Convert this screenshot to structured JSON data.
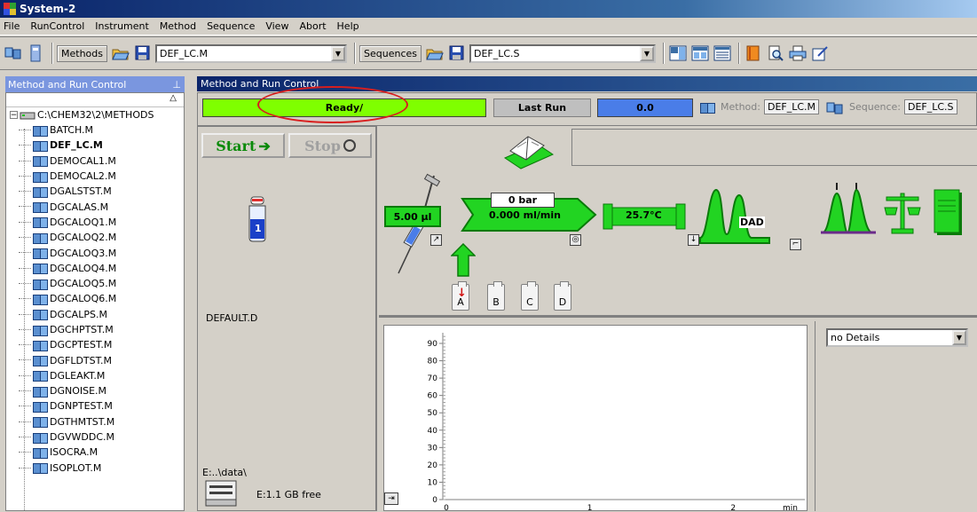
{
  "window": {
    "title": "System-2"
  },
  "menu": [
    "File",
    "RunControl",
    "Instrument",
    "Method",
    "Sequence",
    "View",
    "Abort",
    "Help"
  ],
  "toolbar": {
    "methods_label": "Methods",
    "method_value": "DEF_LC.M",
    "sequences_label": "Sequences",
    "sequence_value": "DEF_LC.S"
  },
  "left_panel": {
    "header": "Method and Run Control",
    "pin": "⊥",
    "sort_indicator": "△",
    "root_path": "C:\\CHEM32\\2\\METHODS",
    "items": [
      {
        "label": "BATCH.M",
        "bold": false
      },
      {
        "label": "DEF_LC.M",
        "bold": true
      },
      {
        "label": "DEMOCAL1.M",
        "bold": false
      },
      {
        "label": "DEMOCAL2.M",
        "bold": false
      },
      {
        "label": "DGALSTST.M",
        "bold": false
      },
      {
        "label": "DGCALAS.M",
        "bold": false
      },
      {
        "label": "DGCALOQ1.M",
        "bold": false
      },
      {
        "label": "DGCALOQ2.M",
        "bold": false
      },
      {
        "label": "DGCALOQ3.M",
        "bold": false
      },
      {
        "label": "DGCALOQ4.M",
        "bold": false
      },
      {
        "label": "DGCALOQ5.M",
        "bold": false
      },
      {
        "label": "DGCALOQ6.M",
        "bold": false
      },
      {
        "label": "DGCALPS.M",
        "bold": false
      },
      {
        "label": "DGCHPTST.M",
        "bold": false
      },
      {
        "label": "DGCPTEST.M",
        "bold": false
      },
      {
        "label": "DGFLDTST.M",
        "bold": false
      },
      {
        "label": "DGLEAKT.M",
        "bold": false
      },
      {
        "label": "DGNOISE.M",
        "bold": false
      },
      {
        "label": "DGNPTEST.M",
        "bold": false
      },
      {
        "label": "DGTHMTST.M",
        "bold": false
      },
      {
        "label": "DGVWDDC.M",
        "bold": false
      },
      {
        "label": "ISOCRA.M",
        "bold": false
      },
      {
        "label": "ISOPLOT.M",
        "bold": false
      }
    ]
  },
  "main": {
    "header": "Method and Run Control",
    "status": "Ready/",
    "last_run_label": "Last Run",
    "last_run_value": "0.0",
    "method_label": "Method:",
    "method_value": "DEF_LC.M",
    "sequence_label": "Sequence:",
    "sequence_value": "DEF_LC.S"
  },
  "run_control": {
    "start_label": "Start",
    "stop_label": "Stop",
    "vial_number": "1",
    "datafile": "DEFAULT.D",
    "data_path": "E:..\\data\\",
    "free_space": "E:1.1 GB free"
  },
  "instrument": {
    "injection_volume": "5.00 µl",
    "pressure": "0 bar",
    "flow": "0.000 ml/min",
    "temperature": "25.7°C",
    "detector": "DAD",
    "bottles": [
      "A",
      "B",
      "C",
      "D"
    ],
    "active_bottle": "A"
  },
  "plot": {
    "y_ticks": [
      "90",
      "80",
      "70",
      "60",
      "50",
      "40",
      "30",
      "20",
      "10",
      "0"
    ],
    "x_ticks": [
      "0",
      "1",
      "2"
    ],
    "x_unit": "min",
    "details_option": "no Details"
  },
  "colors": {
    "ready": "#7fff00",
    "value_bar": "#4a7de8",
    "module_green": "#22d422",
    "highlight_oval": "#d81e1e"
  }
}
